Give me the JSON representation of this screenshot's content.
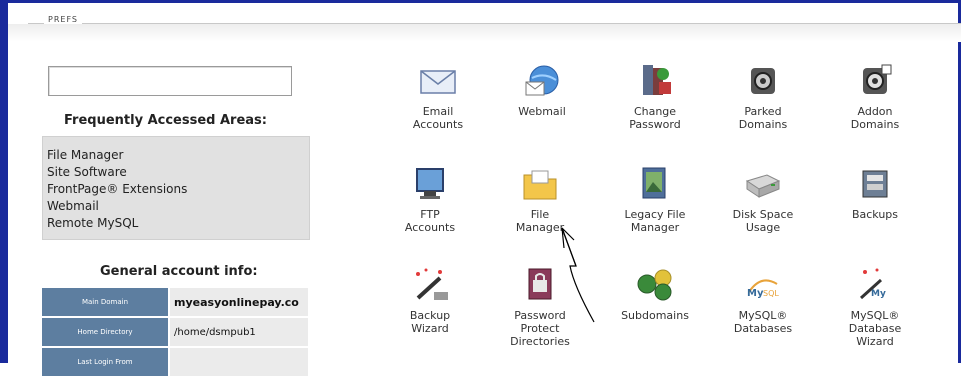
{
  "panel": {
    "legend": "PREFS"
  },
  "search": {
    "value": "",
    "placeholder": ""
  },
  "frequently_accessed": {
    "title": "Frequently Accessed Areas:",
    "items": [
      "File Manager",
      "Site Software",
      "FrontPage® Extensions",
      "Webmail",
      "Remote MySQL"
    ]
  },
  "general_info": {
    "title": "General account info:",
    "rows": [
      {
        "key": "Main Domain",
        "value": "myeasyonlinepay.co"
      },
      {
        "key": "Home Directory",
        "value": "/home/dsmpub1"
      },
      {
        "key": "Last Login From",
        "value": ""
      }
    ]
  },
  "icons": [
    {
      "name": "email-accounts",
      "label_lines": [
        "Email",
        "Accounts"
      ],
      "icon": "envelope-icon"
    },
    {
      "name": "webmail",
      "label_lines": [
        "Webmail"
      ],
      "icon": "globe-mail-icon"
    },
    {
      "name": "change-password",
      "label_lines": [
        "Change",
        "Password"
      ],
      "icon": "key-books-icon"
    },
    {
      "name": "parked-domains",
      "label_lines": [
        "Parked",
        "Domains"
      ],
      "icon": "camera-icon"
    },
    {
      "name": "addon-domains",
      "label_lines": [
        "Addon",
        "Domains"
      ],
      "icon": "camera-add-icon"
    },
    {
      "name": "ftp-accounts",
      "label_lines": [
        "FTP",
        "Accounts"
      ],
      "icon": "monitor-icon"
    },
    {
      "name": "file-manager",
      "label_lines": [
        "File",
        "Manager"
      ],
      "icon": "folder-icon"
    },
    {
      "name": "legacy-file-manager",
      "label_lines": [
        "Legacy File",
        "Manager"
      ],
      "icon": "photo-folder-icon"
    },
    {
      "name": "disk-space-usage",
      "label_lines": [
        "Disk Space",
        "Usage"
      ],
      "icon": "disk-drive-icon"
    },
    {
      "name": "backups",
      "label_lines": [
        "Backups"
      ],
      "icon": "backup-box-icon"
    },
    {
      "name": "backup-wizard",
      "label_lines": [
        "Backup",
        "Wizard"
      ],
      "icon": "wand-icon"
    },
    {
      "name": "password-protect-directories",
      "label_lines": [
        "Password",
        "Protect",
        "Directories"
      ],
      "icon": "lock-book-icon"
    },
    {
      "name": "subdomains",
      "label_lines": [
        "Subdomains"
      ],
      "icon": "www-badges-icon"
    },
    {
      "name": "mysql-databases",
      "label_lines": [
        "MySQL®",
        "Databases"
      ],
      "icon": "mysql-logo-icon"
    },
    {
      "name": "mysql-database-wizard",
      "label_lines": [
        "MySQL®",
        "Database",
        "Wizard"
      ],
      "icon": "mysql-wand-icon"
    }
  ],
  "colors": {
    "frame": "#1a2a9c",
    "info_key_bg": "#5d7ea0",
    "list_bg": "#e1e1e1"
  }
}
